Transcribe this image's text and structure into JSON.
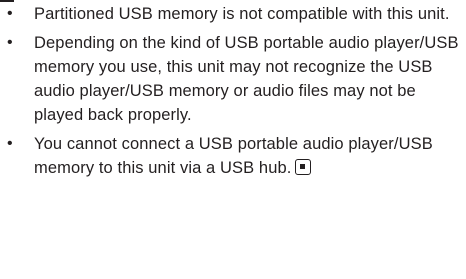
{
  "notes": {
    "bullet_glyph": "•",
    "items": [
      {
        "text": "Partitioned USB memory is not compatible with this unit."
      },
      {
        "text": "Depending on the kind of USB portable audio player/USB memory you use, this unit may not recognize the USB audio player/USB memory or audio files may not be played back properly."
      },
      {
        "text": "You cannot connect a USB portable audio player/USB memory to this unit via a USB hub."
      }
    ],
    "end_mark_icon": "stop-square-icon"
  }
}
